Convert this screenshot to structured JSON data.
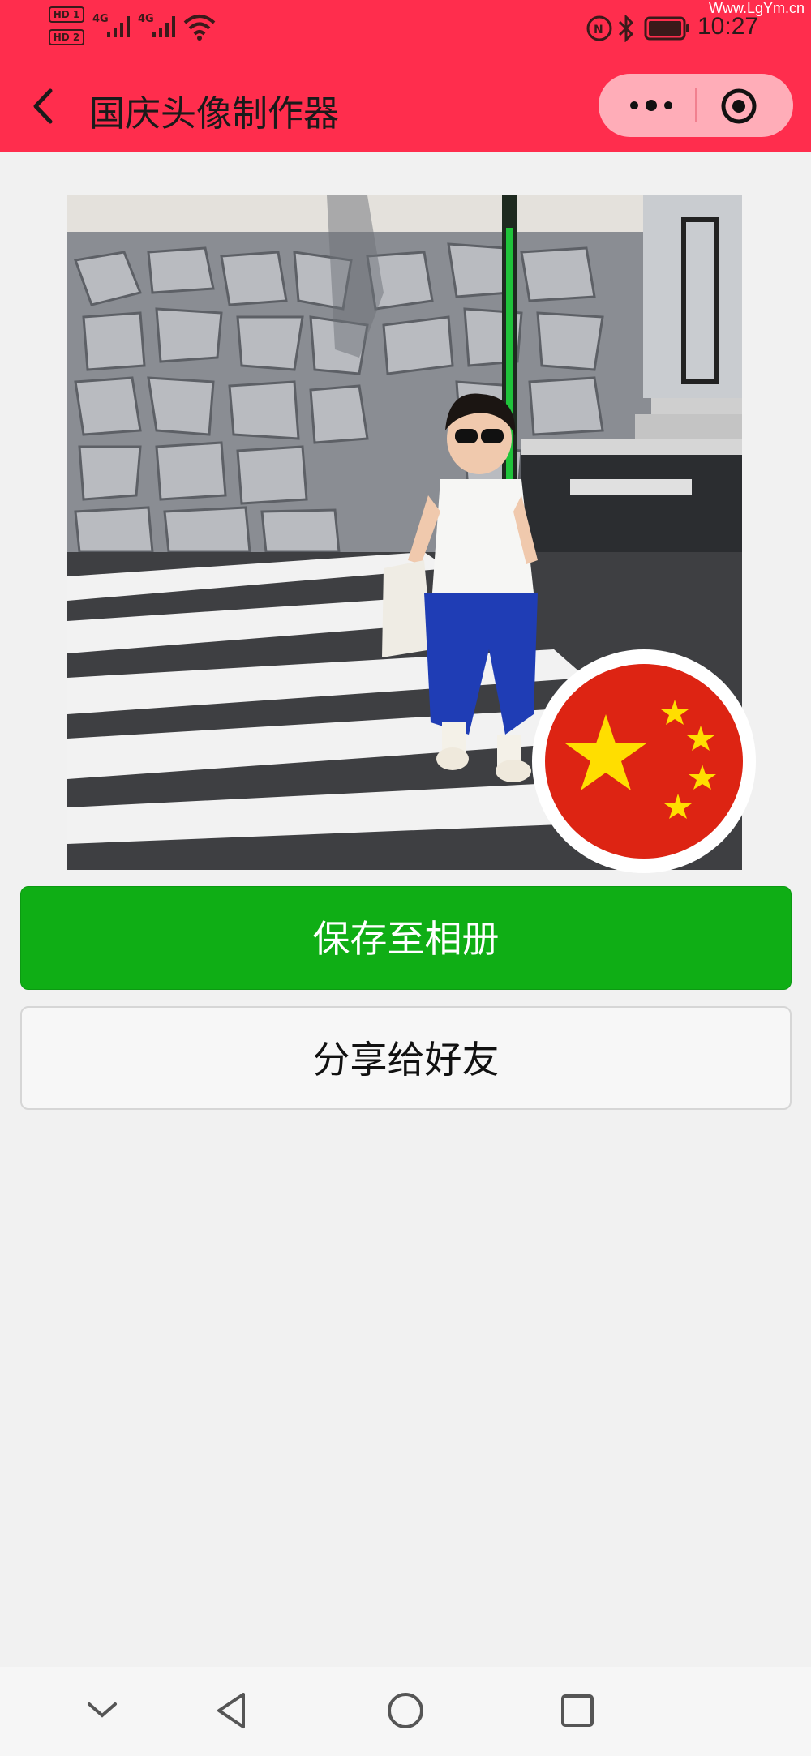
{
  "status_bar": {
    "sim1_badge": "HD 1",
    "sim2_badge": "HD 2",
    "network1": "4G",
    "network2": "4G",
    "time": "10:27",
    "watermark": "Www.LgYm.cn",
    "icons": [
      "signal-icon",
      "wifi-icon",
      "nfc-icon",
      "bluetooth-icon",
      "battery-icon"
    ]
  },
  "nav_bar": {
    "title": "国庆头像制作器",
    "back_icon": "chevron-left-icon",
    "more_icon": "more-dots-icon",
    "close_icon": "target-close-icon",
    "color": "#ff2d4d"
  },
  "content": {
    "avatar_image": "photo-with-flag-badge",
    "badge": "china-flag-badge"
  },
  "actions": {
    "save_label": "保存至相册",
    "share_label": "分享给好友",
    "save_color": "#0fae15"
  },
  "system_nav": {
    "icons": [
      "chevron-down-icon",
      "back-triangle-icon",
      "home-circle-icon",
      "recents-square-icon"
    ]
  }
}
